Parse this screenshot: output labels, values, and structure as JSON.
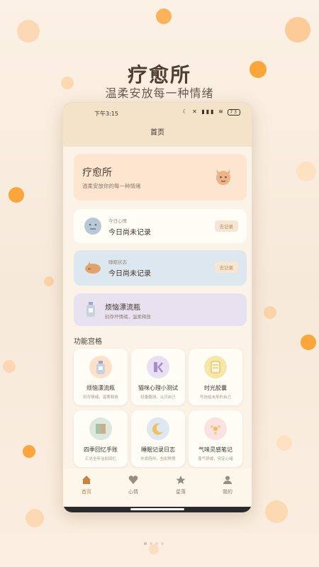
{
  "hero": {
    "title": "疗愈所",
    "subtitle": "温柔安放每一种情绪"
  },
  "status": {
    "time": "下午3:15",
    "battery": "73"
  },
  "nav": {
    "title": "首页"
  },
  "banner": {
    "title": "疗愈所",
    "subtitle": "温柔安放你的每一种情绪"
  },
  "mood": {
    "label": "今日心情",
    "value": "今日尚未记录",
    "action": "去记录"
  },
  "sleep": {
    "label": "睡眠状态",
    "value": "今日尚未记录",
    "action": "去记录"
  },
  "bottle": {
    "title": "烦恼漂流瓶",
    "subtitle": "封存坏情绪，温柔释放"
  },
  "section": {
    "title": "功能宫格"
  },
  "tiles": [
    {
      "title": "烦恼漂流瓶",
      "subtitle": "封存情绪，温柔释放",
      "icon": "bottle-icon"
    },
    {
      "title": "猫咪心理小测试",
      "subtitle": "轻量趣测，认识自己",
      "icon": "cat-test-icon"
    },
    {
      "title": "时光胶囊",
      "subtitle": "写信给未来的自己",
      "icon": "capsule-icon"
    },
    {
      "title": "四季回忆手账",
      "subtitle": "汇总全年治愈回忆",
      "icon": "journal-icon"
    },
    {
      "title": "睡眠记录日志",
      "subtitle": "作息陪伴，告别熬夜",
      "icon": "moon-icon"
    },
    {
      "title": "气味灵感笔记",
      "subtitle": "香气舒缓，安定心绪",
      "icon": "scent-icon"
    }
  ],
  "tabs": [
    {
      "label": "首页",
      "icon": "home-icon"
    },
    {
      "label": "心情",
      "icon": "heart-icon"
    },
    {
      "label": "星落",
      "icon": "star-icon"
    },
    {
      "label": "我的",
      "icon": "user-icon"
    }
  ],
  "colors": {
    "accent": "#c8833f",
    "banner": "#fde5cf",
    "sleep": "#dce7f0",
    "bottle": "#e8e1f0"
  }
}
